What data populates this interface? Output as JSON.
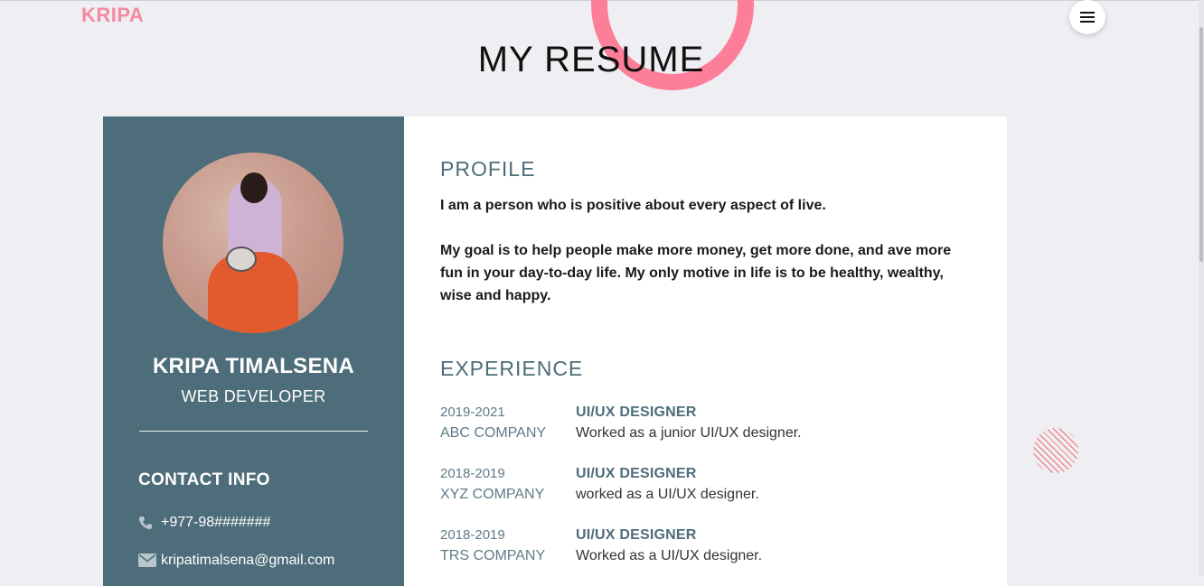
{
  "header": {
    "logo": "KRIPA",
    "title": "MY RESUME"
  },
  "menu_icon": "hamburger-menu-icon",
  "sidebar": {
    "name": "KRIPA TIMALSENA",
    "role": "WEB DEVELOPER",
    "contact_title": "CONTACT INFO",
    "contacts": [
      {
        "icon": "phone-icon",
        "value": "+977-98#######"
      },
      {
        "icon": "mail-icon",
        "value": "kripatimalsena@gmail.com"
      }
    ]
  },
  "profile": {
    "title": "PROFILE",
    "paragraphs": [
      "I am a person who is positive about every aspect of live.",
      "My goal is to help people make more money, get more done, and ave more fun in your day-to-day life. My only motive in life is to be healthy, wealthy, wise and happy."
    ]
  },
  "experience": {
    "title": "EXPERIENCE",
    "items": [
      {
        "years": "2019-2021",
        "company": "ABC COMPANY",
        "role": "UI/UX DESIGNER",
        "desc": "Worked as a junior UI/UX designer."
      },
      {
        "years": "2018-2019",
        "company": "XYZ COMPANY",
        "role": "UI/UX DESIGNER",
        "desc": "worked as a UI/UX designer."
      },
      {
        "years": "2018-2019",
        "company": "TRS COMPANY",
        "role": "UI/UX DESIGNER",
        "desc": "Worked as a UI/UX designer."
      }
    ]
  },
  "colors": {
    "accent_pink": "#fd7e98",
    "sidebar_bg": "#4e6d7a",
    "background": "#efeff3"
  }
}
